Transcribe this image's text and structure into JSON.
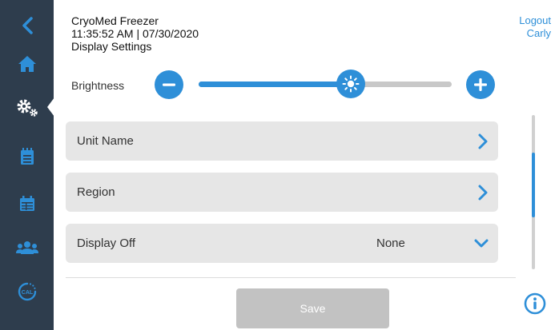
{
  "header": {
    "device_name": "CryoMed Freezer",
    "datetime": "11:35:52 AM | 07/30/2020",
    "page_title": "Display Settings"
  },
  "user": {
    "logout_label": "Logout",
    "username": "Carly"
  },
  "sidebar": {
    "items": [
      {
        "icon": "back-chevron-icon"
      },
      {
        "icon": "home-icon"
      },
      {
        "icon": "settings-gears-icon",
        "active": true
      },
      {
        "icon": "notepad-icon"
      },
      {
        "icon": "calendar-icon"
      },
      {
        "icon": "users-icon"
      },
      {
        "icon": "calibration-icon",
        "text": "CAL"
      }
    ]
  },
  "brightness": {
    "label": "Brightness",
    "level": 0.6
  },
  "settings": [
    {
      "label": "Unit Name",
      "control": "chevron-right"
    },
    {
      "label": "Region",
      "control": "chevron-right"
    },
    {
      "label": "Display Off",
      "value": "None",
      "control": "chevron-down"
    }
  ],
  "scrollbar": {
    "position_fraction": 0.42,
    "visible_fraction": 0.42
  },
  "footer": {
    "save_label": "Save"
  },
  "colors": {
    "sidebar": "#2e3d4d",
    "accent": "#2e8fd8",
    "row_background": "#e6e6e6",
    "disabled_button": "#c2c2c2"
  }
}
